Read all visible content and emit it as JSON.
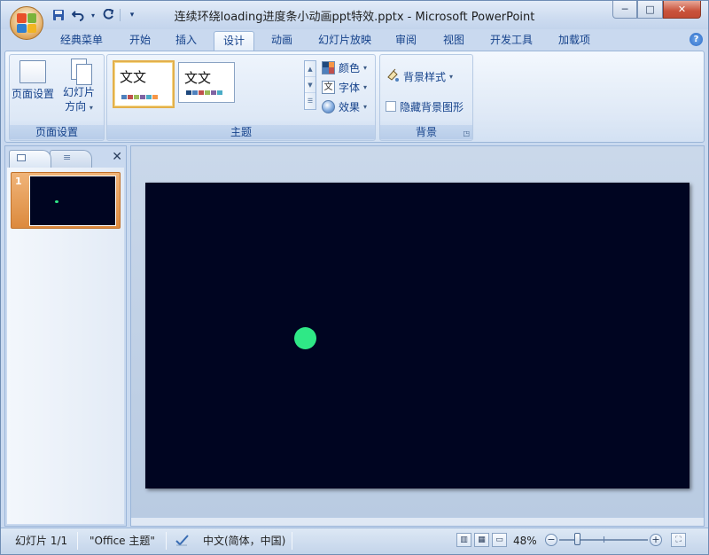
{
  "window": {
    "title": "连续环绕loading进度条小动画ppt特效.pptx - Microsoft PowerPoint",
    "controls": {
      "minimize": "─",
      "maximize": "□",
      "close": "✕"
    }
  },
  "quick_access": {
    "save": "save-icon",
    "undo": "undo-icon",
    "redo": "redo-icon",
    "customize": "▾"
  },
  "tabs": [
    {
      "label": "经典菜单"
    },
    {
      "label": "开始"
    },
    {
      "label": "插入"
    },
    {
      "label": "设计"
    },
    {
      "label": "动画"
    },
    {
      "label": "幻灯片放映"
    },
    {
      "label": "审阅"
    },
    {
      "label": "视图"
    },
    {
      "label": "开发工具"
    },
    {
      "label": "加载项"
    }
  ],
  "active_tab": "设计",
  "help": "?",
  "ribbon": {
    "page_setup": {
      "group_label": "页面设置",
      "page_setup_button": "页面设置",
      "orientation_line1": "幻灯片",
      "orientation_line2": "方向",
      "orientation_caret": "▾"
    },
    "themes": {
      "group_label": "主题",
      "theme1_text": "文文",
      "theme2_text": "文文",
      "colors_label": "颜色",
      "fonts_label": "字体",
      "fonts_icon_text": "文",
      "effects_label": "效果"
    },
    "background": {
      "group_label": "背景",
      "styles_label": "背景样式",
      "hide_graphics_label": "隐藏背景图形"
    }
  },
  "slides_pane": {
    "close": "✕",
    "slide_number": "1"
  },
  "status_bar": {
    "slide_info": "幻灯片 1/1",
    "theme": "\"Office 主题\"",
    "language": "中文(简体，中国)",
    "zoom": "48%",
    "zoom_out": "−",
    "zoom_in": "+",
    "zoom_level_fraction": 0.48
  },
  "colors": {
    "slide_background": "#000521",
    "ball": "#2fe886",
    "selected_thumb": "#dc8a3d"
  }
}
